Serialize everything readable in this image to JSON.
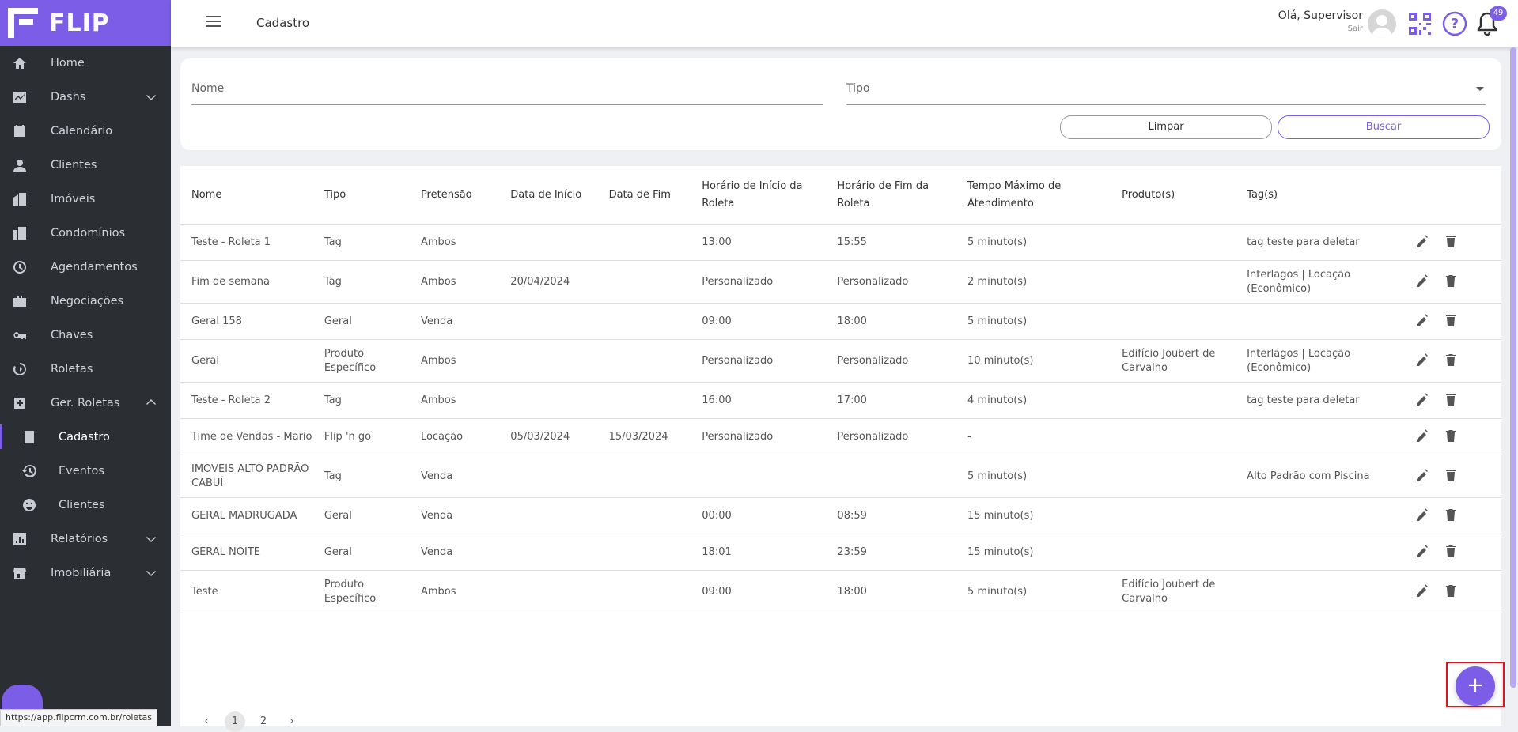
{
  "brand": {
    "name": "FLIP",
    "color": "#7b5de8"
  },
  "sidebar": {
    "items": [
      {
        "label": "Home",
        "icon": "home-icon"
      },
      {
        "label": "Dashs",
        "icon": "chart-icon",
        "expandable": true
      },
      {
        "label": "Calendário",
        "icon": "calendar-icon"
      },
      {
        "label": "Clientes",
        "icon": "person-icon"
      },
      {
        "label": "Imóveis",
        "icon": "building-icon"
      },
      {
        "label": "Condomínios",
        "icon": "condo-icon"
      },
      {
        "label": "Agendamentos",
        "icon": "clock-icon"
      },
      {
        "label": "Negociações",
        "icon": "briefcase-icon"
      },
      {
        "label": "Chaves",
        "icon": "key-icon"
      },
      {
        "label": "Roletas",
        "icon": "roulette-icon"
      },
      {
        "label": "Ger. Roletas",
        "icon": "gear-icon",
        "expanded": true
      },
      {
        "label": "Cadastro",
        "icon": "document-icon",
        "sub": true,
        "active": true
      },
      {
        "label": "Eventos",
        "icon": "history-icon",
        "sub": true
      },
      {
        "label": "Clientes",
        "icon": "face-icon",
        "sub": true
      },
      {
        "label": "Relatórios",
        "icon": "bar-chart-icon",
        "expandable": true
      },
      {
        "label": "Imobiliária",
        "icon": "store-icon",
        "expandable": true
      }
    ]
  },
  "statusbar": {
    "url": "https://app.flipcrm.com.br/roletas"
  },
  "header": {
    "title": "Cadastro",
    "greeting": "Olá, Supervisor",
    "logout": "Sair",
    "notifications": "49"
  },
  "filters": {
    "nome_placeholder": "Nome",
    "tipo_placeholder": "Tipo",
    "clear_label": "Limpar",
    "search_label": "Buscar"
  },
  "table": {
    "columns": [
      "Nome",
      "Tipo",
      "Pretensão",
      "Data de Início",
      "Data de Fim",
      "Horário de Início da Roleta",
      "Horário de Fim da Roleta",
      "Tempo Máximo de Atendimento",
      "Produto(s)",
      "Tag(s)"
    ],
    "rows": [
      [
        "Teste - Roleta 1",
        "Tag",
        "Ambos",
        "",
        "",
        "13:00",
        "15:55",
        "5 minuto(s)",
        "",
        "tag teste para deletar"
      ],
      [
        "Fim de semana",
        "Tag",
        "Ambos",
        "20/04/2024",
        "",
        "Personalizado",
        "Personalizado",
        "2 minuto(s)",
        "",
        "Interlagos | Locação (Econômico)"
      ],
      [
        "Geral 158",
        "Geral",
        "Venda",
        "",
        "",
        "09:00",
        "18:00",
        "5 minuto(s)",
        "",
        ""
      ],
      [
        "Geral",
        "Produto Específico",
        "Ambos",
        "",
        "",
        "Personalizado",
        "Personalizado",
        "10 minuto(s)",
        "Edifício Joubert de Carvalho",
        "Interlagos | Locação (Econômico)"
      ],
      [
        "Teste - Roleta 2",
        "Tag",
        "Ambos",
        "",
        "",
        "16:00",
        "17:00",
        "4 minuto(s)",
        "",
        "tag teste para deletar"
      ],
      [
        "Time de Vendas - Mario",
        "Flip 'n go",
        "Locação",
        "05/03/2024",
        "15/03/2024",
        "Personalizado",
        "Personalizado",
        "-",
        "",
        ""
      ],
      [
        "IMOVEIS ALTO PADRÃO CABUÍ",
        "Tag",
        "Venda",
        "",
        "",
        "",
        "",
        "5 minuto(s)",
        "",
        "Alto Padrão com Piscina"
      ],
      [
        "GERAL MADRUGADA",
        "Geral",
        "Venda",
        "",
        "",
        "00:00",
        "08:59",
        "15 minuto(s)",
        "",
        ""
      ],
      [
        "GERAL NOITE",
        "Geral",
        "Venda",
        "",
        "",
        "18:01",
        "23:59",
        "15 minuto(s)",
        "",
        ""
      ],
      [
        "Teste",
        "Produto Específico",
        "Ambos",
        "",
        "",
        "09:00",
        "18:00",
        "5 minuto(s)",
        "Edifício Joubert de Carvalho",
        ""
      ]
    ]
  },
  "pagination": {
    "prev": "‹",
    "pages": [
      "1",
      "2"
    ],
    "current": "1",
    "next": "›"
  },
  "fab": {
    "label": "+"
  }
}
